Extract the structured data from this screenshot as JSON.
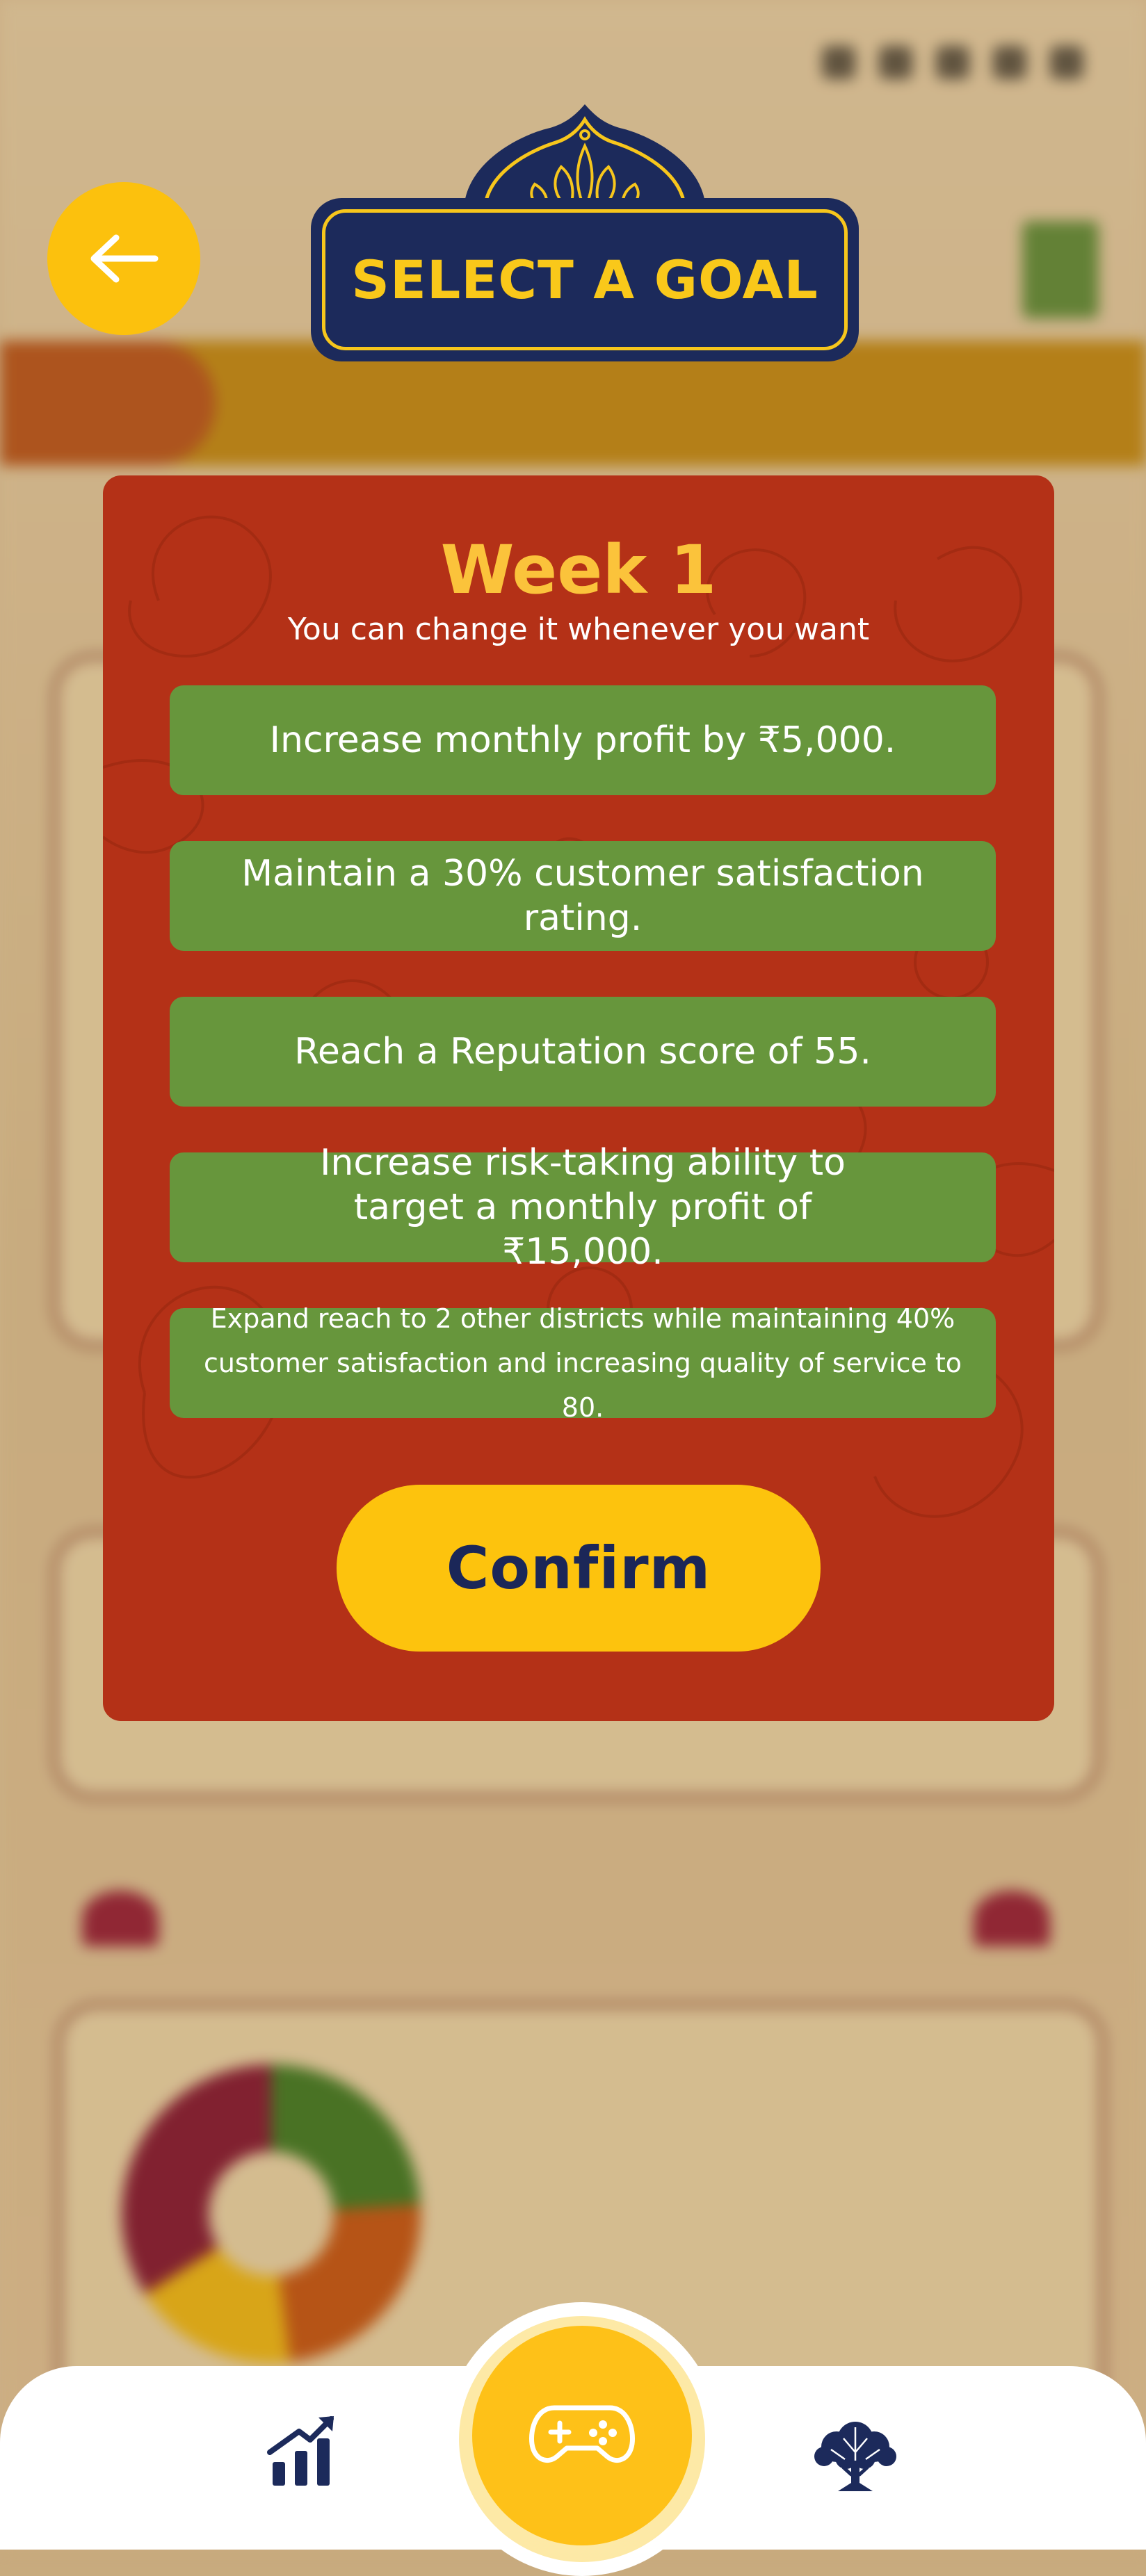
{
  "header": {
    "title": "SELECT A GOAL",
    "back_icon": "arrow-left-icon"
  },
  "modal": {
    "title": "Week 1",
    "subtitle": "You can change it whenever you want",
    "goals": [
      "Increase monthly profit by ₹5,000.",
      "Maintain a 30% customer satisfaction rating.",
      "Reach a Reputation score of 55.",
      "Increase risk-taking ability to target a monthly profit of ₹15,000.",
      "Expand reach to 2 other districts while maintaining 40% customer satisfaction and increasing quality of service to 80."
    ],
    "confirm_label": "Confirm"
  },
  "nav": {
    "items": [
      "stats-icon",
      "gamepad-icon",
      "tree-icon"
    ]
  },
  "colors": {
    "modal_bg": "#b43117",
    "goal_bg": "#67963c",
    "accent_yellow": "#fdc30d",
    "navy": "#1c2a5b"
  }
}
